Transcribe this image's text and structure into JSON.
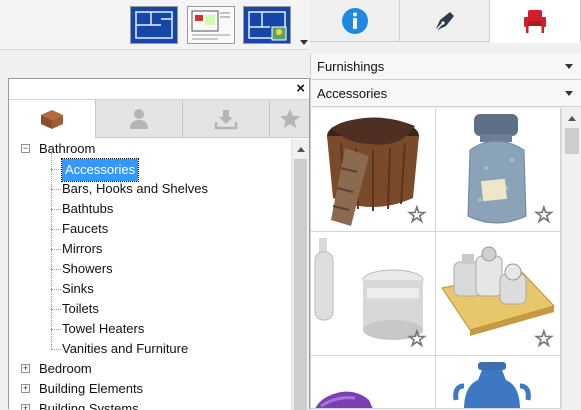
{
  "toolbar": {
    "thumbnails": [
      "floor-plan-view",
      "layout-view",
      "elevation-view"
    ]
  },
  "tabs": [
    {
      "icon": "info-icon",
      "active": false
    },
    {
      "icon": "pen-nib-icon",
      "active": false
    },
    {
      "icon": "armchair-icon",
      "active": true
    }
  ],
  "combos": {
    "category": "Furnishings",
    "subcategory": "Accessories"
  },
  "panel": {
    "close": "×",
    "tabs": [
      "box-icon",
      "person-icon",
      "download-icon",
      "star-icon"
    ]
  },
  "tree": {
    "items": [
      {
        "label": "Bathroom",
        "level": 0,
        "expander": "−"
      },
      {
        "label": "Accessories",
        "level": 1,
        "selected": true
      },
      {
        "label": "Bars, Hooks and Shelves",
        "level": 1
      },
      {
        "label": "Bathtubs",
        "level": 1
      },
      {
        "label": "Faucets",
        "level": 1
      },
      {
        "label": "Mirrors",
        "level": 1
      },
      {
        "label": "Showers",
        "level": 1
      },
      {
        "label": "Sinks",
        "level": 1
      },
      {
        "label": "Toilets",
        "level": 1
      },
      {
        "label": "Towel Heaters",
        "level": 1
      },
      {
        "label": "Vanities and Furniture",
        "level": 1
      },
      {
        "label": "Bedroom",
        "level": 0,
        "expander": "+"
      },
      {
        "label": "Building Elements",
        "level": 0,
        "expander": "+"
      },
      {
        "label": "Building Systems",
        "level": 0,
        "expander": "+"
      }
    ]
  },
  "grid": {
    "items": [
      "basket-with-towel",
      "stone-jar",
      "soap-dispenser-set",
      "tray-with-jars",
      "purple-item",
      "blue-vase"
    ]
  },
  "colors": {
    "selection": "#3399ff",
    "info_blue": "#1e88e5",
    "chair_red": "#d01f2a"
  }
}
